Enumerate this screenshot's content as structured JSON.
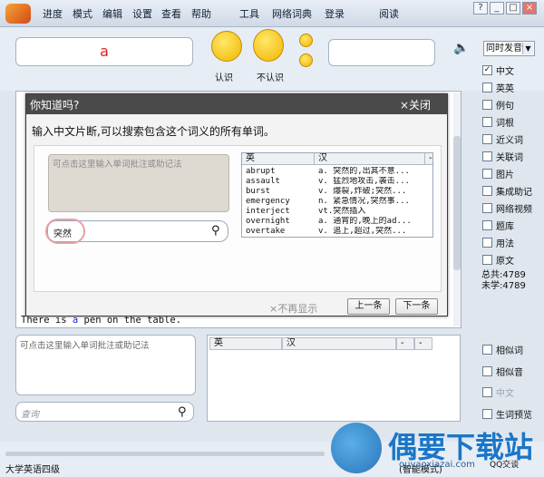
{
  "menu": [
    "进度",
    "模式",
    "编辑",
    "设置",
    "查看",
    "帮助",
    "工具",
    "网络词典",
    "登录",
    "阅读"
  ],
  "window_buttons": [
    "?",
    "_",
    "□",
    "×"
  ],
  "current_word": "a",
  "faces": {
    "know_label": "认识",
    "notknow_label": "不认识"
  },
  "sync_select": {
    "value": "同时发音"
  },
  "options": [
    {
      "label": "中文",
      "checked": true,
      "enabled": true
    },
    {
      "label": "英英",
      "checked": false,
      "enabled": true
    },
    {
      "label": "例句",
      "checked": false,
      "enabled": true
    },
    {
      "label": "词根",
      "checked": false,
      "enabled": true
    },
    {
      "label": "近义词",
      "checked": false,
      "enabled": true
    },
    {
      "label": "关联词",
      "checked": false,
      "enabled": true
    },
    {
      "label": "图片",
      "checked": false,
      "enabled": true
    },
    {
      "label": "集成助记",
      "checked": false,
      "enabled": true
    },
    {
      "label": "网络视频",
      "checked": false,
      "enabled": true
    },
    {
      "label": "题库",
      "checked": false,
      "enabled": true
    },
    {
      "label": "用法",
      "checked": false,
      "enabled": true
    },
    {
      "label": "原文",
      "checked": false,
      "enabled": true
    }
  ],
  "stats": {
    "total": "总共:4789",
    "unlearned": "未学:4789"
  },
  "example_sentence": {
    "before": "There is ",
    "highlight": "a",
    "after": " pen on the table."
  },
  "tip": {
    "title": "你知道吗?",
    "close": "×关闭",
    "description": "输入中文片断,可以搜索包含这个词义的所有单词。",
    "note_placeholder": "可点击这里输入单词批注或助记法",
    "search_value": "突然",
    "table_headers": [
      "英",
      "汉",
      "-"
    ],
    "rows": [
      {
        "en": "abrupt",
        "cn": "a. 突然的,出其不意..."
      },
      {
        "en": "assault",
        "cn": "v. 猛烈地攻击,袭击..."
      },
      {
        "en": "burst",
        "cn": "v. 爆裂,炸破;突然..."
      },
      {
        "en": "emergency",
        "cn": "n. 紧急情况,突然事..."
      },
      {
        "en": "interject",
        "cn": "vt.突然插入"
      },
      {
        "en": "overnight",
        "cn": "a. 通宵的,晚上的ad..."
      },
      {
        "en": "overtake",
        "cn": "v. 追上,超过,突然..."
      }
    ],
    "no_show": "×不再显示",
    "prev": "上一条",
    "next": "下一条"
  },
  "note_area": {
    "placeholder": "可点击这里输入单词批注或助记法"
  },
  "search": {
    "placeholder": "查询"
  },
  "result_table": {
    "headers": [
      "英",
      "汉",
      "-",
      "-"
    ]
  },
  "side_options2": [
    {
      "label": "相似词",
      "checked": false,
      "enabled": true
    },
    {
      "label": "相似音",
      "checked": false,
      "enabled": true
    },
    {
      "label": "中文",
      "checked": false,
      "enabled": false
    },
    {
      "label": "生词预览",
      "checked": false,
      "enabled": true
    }
  ],
  "bottom": {
    "book": "大学英语四级",
    "mode": "(智能模式)",
    "qq": "QQ交谈"
  },
  "watermark": {
    "text": "偶要下载站",
    "url": "ouyaoxiazai.com"
  }
}
